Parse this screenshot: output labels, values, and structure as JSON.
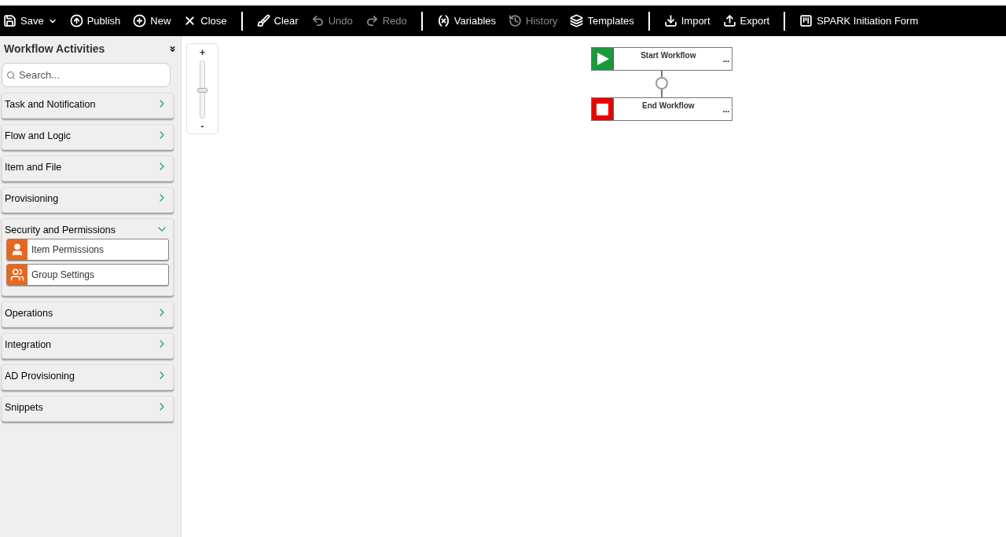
{
  "toolbar": [
    {
      "kind": "button",
      "label": "Save",
      "disabled": false,
      "dropdown": true
    },
    {
      "kind": "button",
      "label": "Publish",
      "disabled": false
    },
    {
      "kind": "button",
      "label": "New",
      "disabled": false
    },
    {
      "kind": "button",
      "label": "Close",
      "disabled": false
    },
    {
      "kind": "separator"
    },
    {
      "kind": "button",
      "label": "Clear",
      "disabled": false
    },
    {
      "kind": "button",
      "label": "Undo",
      "disabled": true
    },
    {
      "kind": "button",
      "label": "Redo",
      "disabled": true
    },
    {
      "kind": "separator"
    },
    {
      "kind": "button",
      "label": "Variables",
      "disabled": false
    },
    {
      "kind": "button",
      "label": "History",
      "disabled": true
    },
    {
      "kind": "button",
      "label": "Templates",
      "disabled": false
    },
    {
      "kind": "separator"
    },
    {
      "kind": "button",
      "label": "Import",
      "disabled": false
    },
    {
      "kind": "button",
      "label": "Export",
      "disabled": false
    },
    {
      "kind": "separator"
    },
    {
      "kind": "button",
      "label": "SPARK Initiation Form",
      "disabled": false
    }
  ],
  "sidebar": {
    "title": "Workflow Activities",
    "search": {
      "placeholder": "Search..."
    },
    "categories": [
      {
        "label": "Task and Notification",
        "expanded": false
      },
      {
        "label": "Flow and Logic",
        "expanded": false
      },
      {
        "label": "Item and File",
        "expanded": false
      },
      {
        "label": "Provisioning",
        "expanded": false
      },
      {
        "label": "Security and Permissions",
        "expanded": true,
        "items": [
          "Item Permissions",
          "Group Settings"
        ]
      },
      {
        "label": "Operations",
        "expanded": false
      },
      {
        "label": "Integration",
        "expanded": false
      },
      {
        "label": "AD Provisioning",
        "expanded": false
      },
      {
        "label": "Snippets",
        "expanded": false
      }
    ]
  },
  "zoom": {
    "plus": "+",
    "minus": "-",
    "level": 0.5
  },
  "canvas": {
    "nodes": [
      {
        "kind": "start",
        "title": "Start Workflow",
        "menu": "..."
      },
      {
        "kind": "end",
        "title": "End Workflow",
        "menu": "..."
      }
    ]
  }
}
